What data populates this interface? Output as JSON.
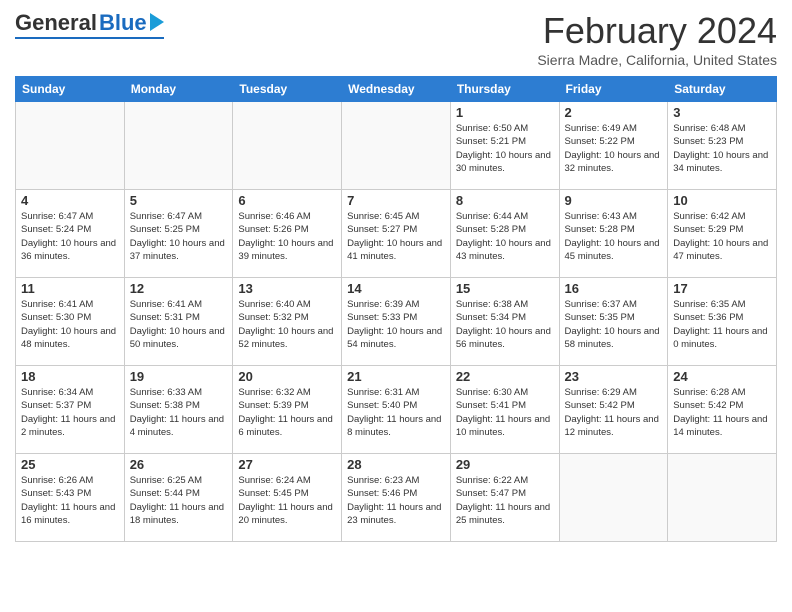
{
  "header": {
    "logo": {
      "general": "General",
      "blue": "Blue"
    },
    "title": "February 2024",
    "location": "Sierra Madre, California, United States"
  },
  "days_of_week": [
    "Sunday",
    "Monday",
    "Tuesday",
    "Wednesday",
    "Thursday",
    "Friday",
    "Saturday"
  ],
  "weeks": [
    [
      {
        "day": "",
        "empty": true
      },
      {
        "day": "",
        "empty": true
      },
      {
        "day": "",
        "empty": true
      },
      {
        "day": "",
        "empty": true
      },
      {
        "day": "1",
        "sunrise": "Sunrise: 6:50 AM",
        "sunset": "Sunset: 5:21 PM",
        "daylight": "Daylight: 10 hours and 30 minutes."
      },
      {
        "day": "2",
        "sunrise": "Sunrise: 6:49 AM",
        "sunset": "Sunset: 5:22 PM",
        "daylight": "Daylight: 10 hours and 32 minutes."
      },
      {
        "day": "3",
        "sunrise": "Sunrise: 6:48 AM",
        "sunset": "Sunset: 5:23 PM",
        "daylight": "Daylight: 10 hours and 34 minutes."
      }
    ],
    [
      {
        "day": "4",
        "sunrise": "Sunrise: 6:47 AM",
        "sunset": "Sunset: 5:24 PM",
        "daylight": "Daylight: 10 hours and 36 minutes."
      },
      {
        "day": "5",
        "sunrise": "Sunrise: 6:47 AM",
        "sunset": "Sunset: 5:25 PM",
        "daylight": "Daylight: 10 hours and 37 minutes."
      },
      {
        "day": "6",
        "sunrise": "Sunrise: 6:46 AM",
        "sunset": "Sunset: 5:26 PM",
        "daylight": "Daylight: 10 hours and 39 minutes."
      },
      {
        "day": "7",
        "sunrise": "Sunrise: 6:45 AM",
        "sunset": "Sunset: 5:27 PM",
        "daylight": "Daylight: 10 hours and 41 minutes."
      },
      {
        "day": "8",
        "sunrise": "Sunrise: 6:44 AM",
        "sunset": "Sunset: 5:28 PM",
        "daylight": "Daylight: 10 hours and 43 minutes."
      },
      {
        "day": "9",
        "sunrise": "Sunrise: 6:43 AM",
        "sunset": "Sunset: 5:28 PM",
        "daylight": "Daylight: 10 hours and 45 minutes."
      },
      {
        "day": "10",
        "sunrise": "Sunrise: 6:42 AM",
        "sunset": "Sunset: 5:29 PM",
        "daylight": "Daylight: 10 hours and 47 minutes."
      }
    ],
    [
      {
        "day": "11",
        "sunrise": "Sunrise: 6:41 AM",
        "sunset": "Sunset: 5:30 PM",
        "daylight": "Daylight: 10 hours and 48 minutes."
      },
      {
        "day": "12",
        "sunrise": "Sunrise: 6:41 AM",
        "sunset": "Sunset: 5:31 PM",
        "daylight": "Daylight: 10 hours and 50 minutes."
      },
      {
        "day": "13",
        "sunrise": "Sunrise: 6:40 AM",
        "sunset": "Sunset: 5:32 PM",
        "daylight": "Daylight: 10 hours and 52 minutes."
      },
      {
        "day": "14",
        "sunrise": "Sunrise: 6:39 AM",
        "sunset": "Sunset: 5:33 PM",
        "daylight": "Daylight: 10 hours and 54 minutes."
      },
      {
        "day": "15",
        "sunrise": "Sunrise: 6:38 AM",
        "sunset": "Sunset: 5:34 PM",
        "daylight": "Daylight: 10 hours and 56 minutes."
      },
      {
        "day": "16",
        "sunrise": "Sunrise: 6:37 AM",
        "sunset": "Sunset: 5:35 PM",
        "daylight": "Daylight: 10 hours and 58 minutes."
      },
      {
        "day": "17",
        "sunrise": "Sunrise: 6:35 AM",
        "sunset": "Sunset: 5:36 PM",
        "daylight": "Daylight: 11 hours and 0 minutes."
      }
    ],
    [
      {
        "day": "18",
        "sunrise": "Sunrise: 6:34 AM",
        "sunset": "Sunset: 5:37 PM",
        "daylight": "Daylight: 11 hours and 2 minutes."
      },
      {
        "day": "19",
        "sunrise": "Sunrise: 6:33 AM",
        "sunset": "Sunset: 5:38 PM",
        "daylight": "Daylight: 11 hours and 4 minutes."
      },
      {
        "day": "20",
        "sunrise": "Sunrise: 6:32 AM",
        "sunset": "Sunset: 5:39 PM",
        "daylight": "Daylight: 11 hours and 6 minutes."
      },
      {
        "day": "21",
        "sunrise": "Sunrise: 6:31 AM",
        "sunset": "Sunset: 5:40 PM",
        "daylight": "Daylight: 11 hours and 8 minutes."
      },
      {
        "day": "22",
        "sunrise": "Sunrise: 6:30 AM",
        "sunset": "Sunset: 5:41 PM",
        "daylight": "Daylight: 11 hours and 10 minutes."
      },
      {
        "day": "23",
        "sunrise": "Sunrise: 6:29 AM",
        "sunset": "Sunset: 5:42 PM",
        "daylight": "Daylight: 11 hours and 12 minutes."
      },
      {
        "day": "24",
        "sunrise": "Sunrise: 6:28 AM",
        "sunset": "Sunset: 5:42 PM",
        "daylight": "Daylight: 11 hours and 14 minutes."
      }
    ],
    [
      {
        "day": "25",
        "sunrise": "Sunrise: 6:26 AM",
        "sunset": "Sunset: 5:43 PM",
        "daylight": "Daylight: 11 hours and 16 minutes."
      },
      {
        "day": "26",
        "sunrise": "Sunrise: 6:25 AM",
        "sunset": "Sunset: 5:44 PM",
        "daylight": "Daylight: 11 hours and 18 minutes."
      },
      {
        "day": "27",
        "sunrise": "Sunrise: 6:24 AM",
        "sunset": "Sunset: 5:45 PM",
        "daylight": "Daylight: 11 hours and 20 minutes."
      },
      {
        "day": "28",
        "sunrise": "Sunrise: 6:23 AM",
        "sunset": "Sunset: 5:46 PM",
        "daylight": "Daylight: 11 hours and 23 minutes."
      },
      {
        "day": "29",
        "sunrise": "Sunrise: 6:22 AM",
        "sunset": "Sunset: 5:47 PM",
        "daylight": "Daylight: 11 hours and 25 minutes."
      },
      {
        "day": "",
        "empty": true
      },
      {
        "day": "",
        "empty": true
      }
    ]
  ]
}
